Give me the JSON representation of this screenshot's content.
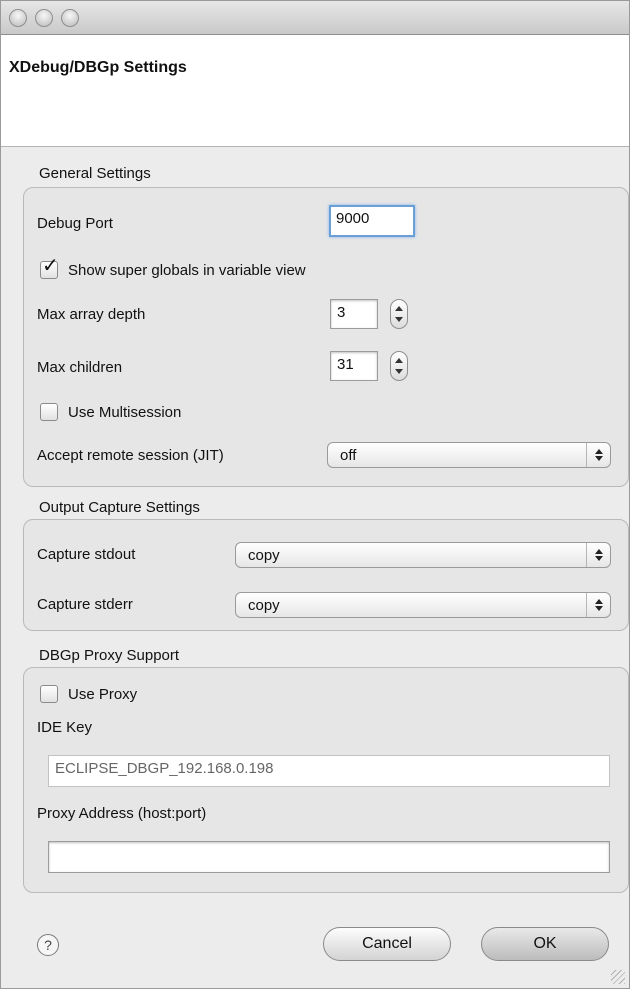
{
  "dialog": {
    "title": "XDebug/DBGp Settings"
  },
  "general": {
    "group_label": "General Settings",
    "debug_port_label": "Debug Port",
    "debug_port_value": "9000",
    "show_super_globals_label": "Show super globals in variable view",
    "show_super_globals_checked": true,
    "max_array_depth_label": "Max array depth",
    "max_array_depth_value": "3",
    "max_children_label": "Max children",
    "max_children_value": "31",
    "use_multisession_label": "Use Multisession",
    "use_multisession_checked": false,
    "accept_remote_label": "Accept remote session (JIT)",
    "accept_remote_value": "off"
  },
  "output": {
    "group_label": "Output Capture Settings",
    "stdout_label": "Capture stdout",
    "stdout_value": "copy",
    "stderr_label": "Capture stderr",
    "stderr_value": "copy"
  },
  "proxy": {
    "group_label": "DBGp Proxy Support",
    "use_proxy_label": "Use Proxy",
    "use_proxy_checked": false,
    "ide_key_label": "IDE Key",
    "ide_key_value": "ECLIPSE_DBGP_192.168.0.198",
    "proxy_address_label": "Proxy Address (host:port)",
    "proxy_address_value": ""
  },
  "footer": {
    "help_glyph": "?",
    "cancel_label": "Cancel",
    "ok_label": "OK"
  },
  "icons": {
    "window_buttons": [
      "close-button-icon",
      "minimize-button-icon",
      "zoom-button-icon"
    ],
    "help": "help-icon",
    "resize": "resize-grip-icon"
  },
  "colors": {
    "focus_ring": "#6a9fd8",
    "group_background": "#e6e6e6",
    "header_background": "#ffffff"
  }
}
